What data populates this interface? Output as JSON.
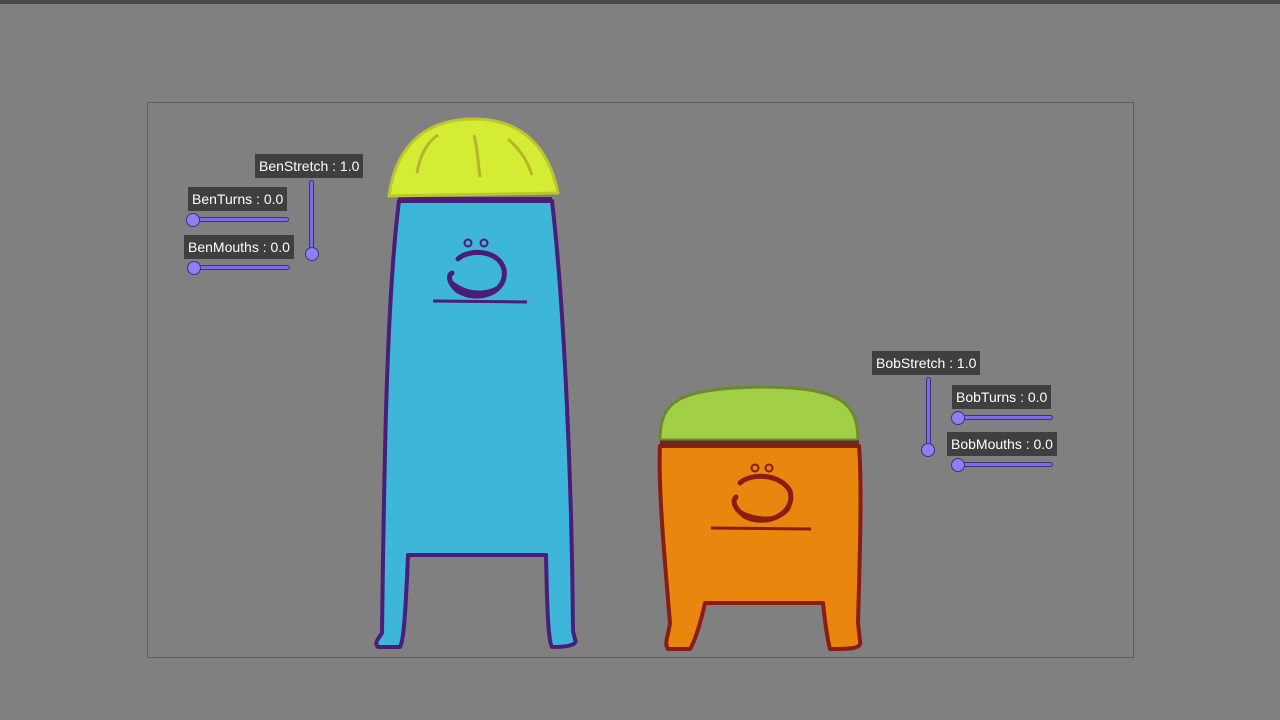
{
  "controls": {
    "ben_stretch": {
      "label": "BenStretch : 1.0",
      "value": 1.0
    },
    "ben_turns": {
      "label": "BenTurns : 0.0",
      "value": 0.0
    },
    "ben_mouths": {
      "label": "BenMouths : 0.0",
      "value": 0.0
    },
    "bob_stretch": {
      "label": "BobStretch : 1.0",
      "value": 1.0
    },
    "bob_turns": {
      "label": "BobTurns : 0.0",
      "value": 0.0
    },
    "bob_mouths": {
      "label": "BobMouths : 0.0",
      "value": 0.0
    }
  },
  "colors": {
    "background": "#808080",
    "slider_fill": "#7a6ee8",
    "label_bg": "#3f3f3f",
    "ben_body": "#3eb6d9",
    "ben_outline": "#4a1d78",
    "ben_hat": "#d4ec33",
    "bob_body": "#e9860e",
    "bob_outline": "#8a1d12",
    "bob_hat": "#a1d046"
  }
}
